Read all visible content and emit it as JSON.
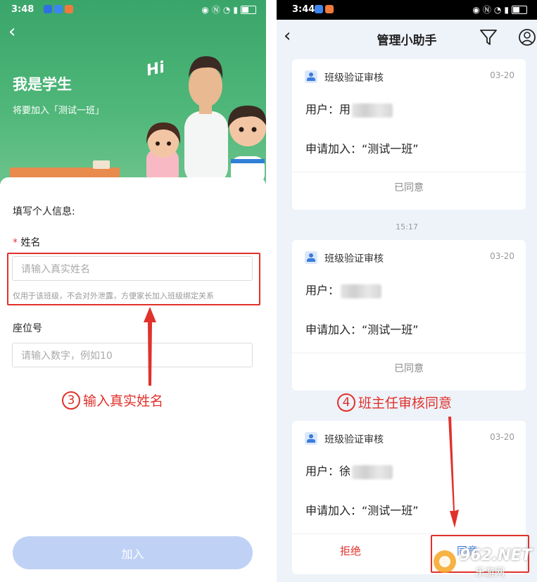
{
  "left": {
    "status_bar": {
      "time": "3:48"
    },
    "header": {
      "title": "我是学生",
      "subtitle": "将要加入「测试一班」",
      "greeting": "Hi"
    },
    "form": {
      "section_title": "填写个人信息:",
      "name": {
        "required_mark": "*",
        "label": "姓名",
        "placeholder": "请输入真实姓名",
        "hint": "仅用于该班级，不会对外泄露，方便家长加入班级绑定关系"
      },
      "seat": {
        "label": "座位号",
        "placeholder": "请输入数字，例如10"
      },
      "submit_label": "加入"
    },
    "annotation": {
      "number": "3",
      "text": "输入真实姓名"
    }
  },
  "right": {
    "status_bar": {
      "time": "3:44"
    },
    "header": {
      "title": "管理小助手"
    },
    "cards": [
      {
        "title": "班级验证审核",
        "date": "03-20",
        "user_label": "用户：",
        "user_visible": "用",
        "apply": "申请加入：“测试一班”",
        "status": "已同意"
      },
      {
        "title": "班级验证审核",
        "date": "03-20",
        "user_label": "用户：",
        "user_visible": "",
        "apply": "申请加入：“测试一班”",
        "status": "已同意"
      },
      {
        "title": "班级验证审核",
        "date": "03-20",
        "user_label": "用户：",
        "user_visible": "徐",
        "apply": "申请加入：“测试一班”",
        "reject_label": "拒绝",
        "agree_label": "同意"
      }
    ],
    "timestamp": "15:17",
    "annotation": {
      "number": "4",
      "text": "班主任审核同意"
    }
  },
  "watermark": {
    "brand": "962.NET",
    "sub": "乐游网"
  },
  "colors": {
    "accent_red": "#e0312b",
    "hero_green": "#4fb779",
    "button_disabled": "#bfd2f5"
  }
}
